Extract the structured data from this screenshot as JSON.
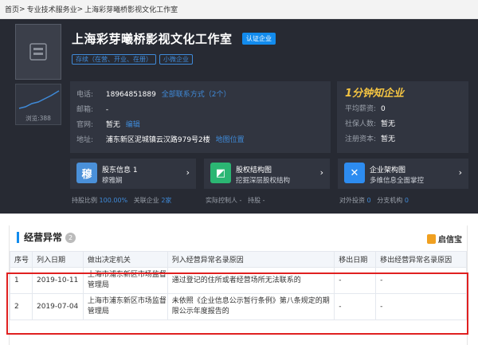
{
  "breadcrumb": {
    "home": "首页",
    "sep1": ">",
    "industry": "专业技术服务业",
    "sep2": ">",
    "current": "上海彩芽曦桥影视文化工作室"
  },
  "company": {
    "name": "上海彩芽曦桥影视文化工作室",
    "certified": "认证企业",
    "tags": [
      "存续（在营、开业、在册）",
      "小微企业"
    ]
  },
  "trend": {
    "views_label": "浏览:388"
  },
  "contact": {
    "phone_label": "电话:",
    "phone": "18964851889",
    "phone_link": "全部联系方式（2个）",
    "email_label": "邮箱:",
    "email": "-",
    "site_label": "官网:",
    "site": "暂无",
    "site_link": "编辑",
    "addr_label": "地址:",
    "addr": "浦东新区泥城镇云汉路979号2楼",
    "addr_link": "地图位置"
  },
  "side": {
    "brand": "1分钟知企业",
    "rows": [
      {
        "k": "平均薪资:",
        "v": "0"
      },
      {
        "k": "社保人数:",
        "v": "暂无"
      },
      {
        "k": "注册资本:",
        "v": "暂无"
      }
    ]
  },
  "cards": [
    {
      "icon": "穆",
      "title": "股东信息 1",
      "sub": "穆雅娴",
      "color": "#4a90d9"
    },
    {
      "icon": "◩",
      "title": "股权结构图",
      "sub": "挖掘深层股权结构",
      "color": "#2bb673"
    },
    {
      "icon": "✕",
      "title": "企业架构图",
      "sub": "多维信息全面掌控",
      "color": "#2d8cf0"
    }
  ],
  "footer": {
    "f1a": "持股比例",
    "f1b": "100.00%",
    "f1c": "关联企业",
    "f1d": "2家",
    "f2a": "实际控制人 -",
    "f2b": "持股 -",
    "f3a": "对外投资",
    "f3b": "0",
    "f3c": "分支机构",
    "f3d": "0"
  },
  "section": {
    "title": "经营异常",
    "count": "2",
    "source": "启信宝"
  },
  "table": {
    "headers": [
      "序号",
      "列入日期",
      "做出决定机关",
      "列入经营异常名录原因",
      "移出日期",
      "移出经营异常名录原因"
    ],
    "rows": [
      [
        "1",
        "2019-10-11",
        "上海市浦东新区市场监督管理局",
        "通过登记的住所或者经营场所无法联系的",
        "-",
        "-"
      ],
      [
        "2",
        "2019-07-04",
        "上海市浦东新区市场监督管理局",
        "未依照《企业信息公示暂行条例》第八条规定的期限公示年度报告的",
        "-",
        "-"
      ]
    ]
  },
  "colors": {
    "accent": "#128bed",
    "dark_bg": "#272a33",
    "highlight": "#e02020"
  }
}
